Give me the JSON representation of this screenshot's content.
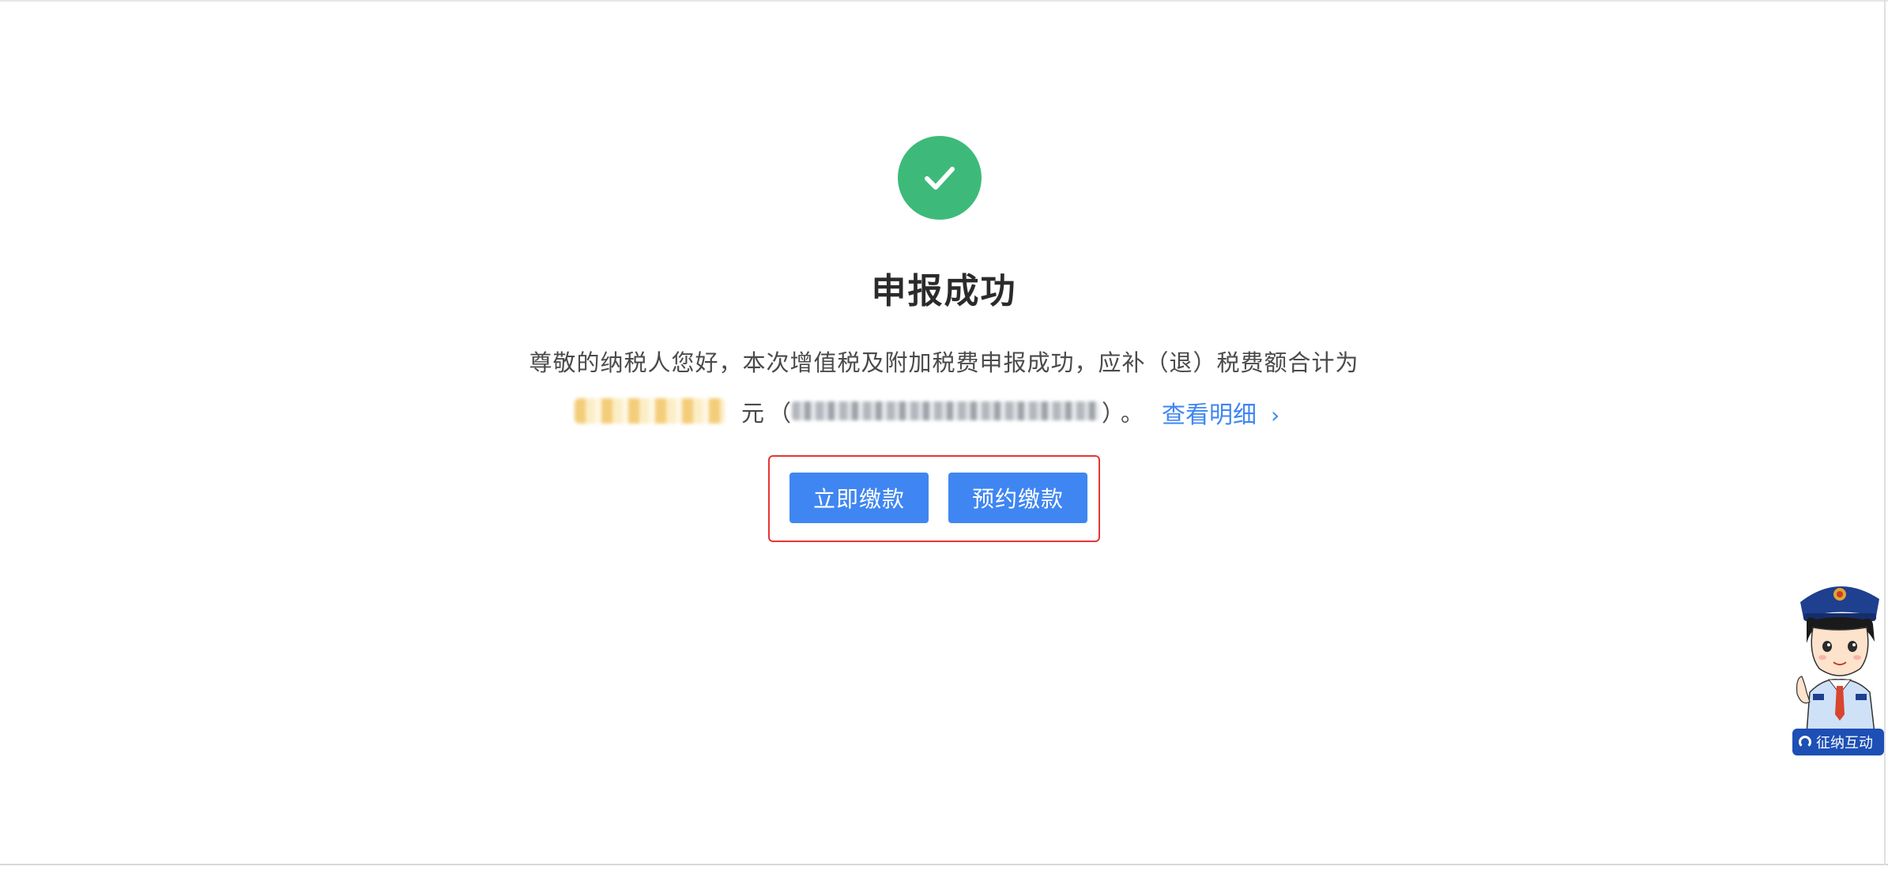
{
  "result": {
    "title": "申报成功",
    "message": "尊敬的纳税人您好，本次增值税及附加税费申报成功，应补（退）税费额合计为",
    "currency_unit": "元",
    "paren_open": "（",
    "paren_close": "）",
    "period": "。",
    "detail_link_label": "查看明细",
    "detail_chevron": "›"
  },
  "actions": {
    "pay_now_label": "立即缴款",
    "schedule_pay_label": "预约缴款"
  },
  "assistant": {
    "label": "征纳互动"
  },
  "colors": {
    "success": "#3dba7a",
    "primary": "#3f86f2",
    "highlight": "#e63535",
    "assistant_badge": "#1d4fb5"
  },
  "icons": {
    "success": "check-circle-icon",
    "chevron": "chevron-right-icon",
    "headset": "headset-icon"
  }
}
